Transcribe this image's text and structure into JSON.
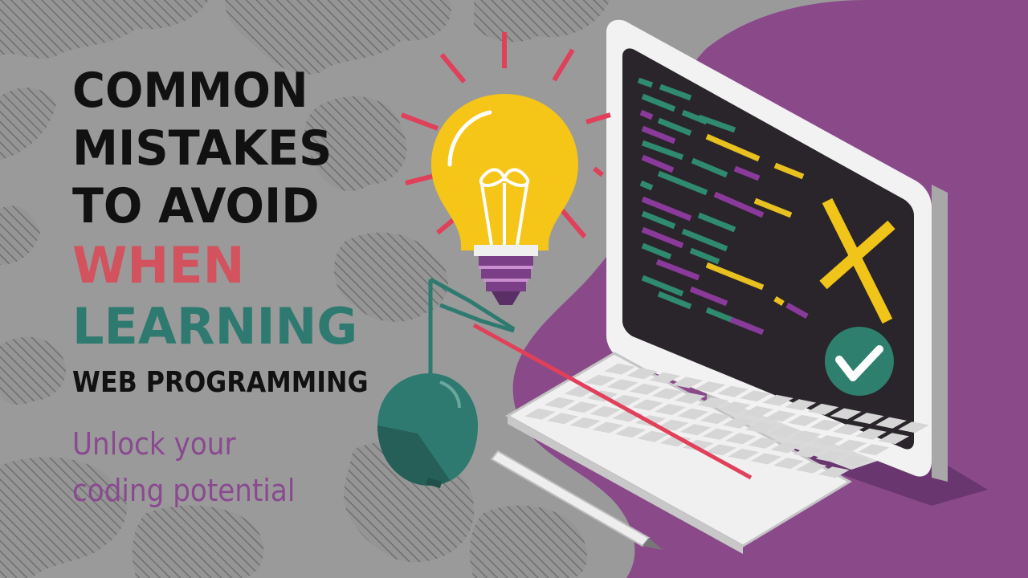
{
  "headline": {
    "line1": "COMMON",
    "line2": "MISTAKES",
    "line3": "TO AVOID",
    "line4": "WHEN",
    "line5": "LEARNING",
    "line6": "WEB PROGRAMMING"
  },
  "tagline": {
    "line1": "Unlock your",
    "line2": "coding potential"
  },
  "colors": {
    "background": "#9a9a9a",
    "headline": "#111111",
    "when": "#d2525e",
    "learning": "#2f7a70",
    "tagline": "#8a4a90",
    "purple_blob": "#8a4a8a",
    "bulb": "#f5c518",
    "screen": "#2a252a",
    "check_circle": "#2f7f6e",
    "x_mark": "#f0c419",
    "ray": "#e0405a"
  },
  "icons": {
    "lightbulb": "lightbulb-icon",
    "monitor": "monitor-icon",
    "keyboard": "keyboard-icon",
    "mouse": "mouse-icon",
    "x_mark": "x-mark-icon",
    "checkmark": "checkmark-icon"
  }
}
